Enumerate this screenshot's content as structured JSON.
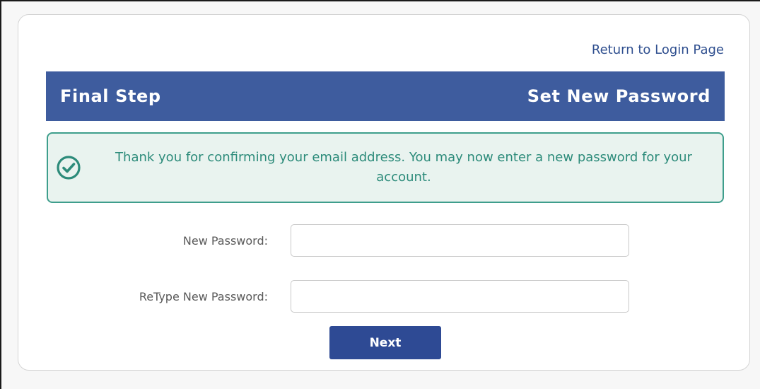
{
  "links": {
    "return_login": "Return to Login Page"
  },
  "header": {
    "step_label": "Final Step",
    "title": "Set New Password"
  },
  "notice": {
    "icon": "check-circle-icon",
    "message": "Thank you for confirming your email address. You may now enter a new password for your account."
  },
  "form": {
    "new_password_label": "New Password:",
    "new_password_value": "",
    "retype_password_label": "ReType New Password:",
    "retype_password_value": "",
    "next_label": "Next"
  },
  "colors": {
    "header_bg": "#3e5c9e",
    "link": "#2f4f8f",
    "notice_border": "#3e9e8c",
    "notice_bg": "#e9f3ef",
    "notice_text": "#2c8b7a",
    "button_bg": "#2e4a94"
  }
}
